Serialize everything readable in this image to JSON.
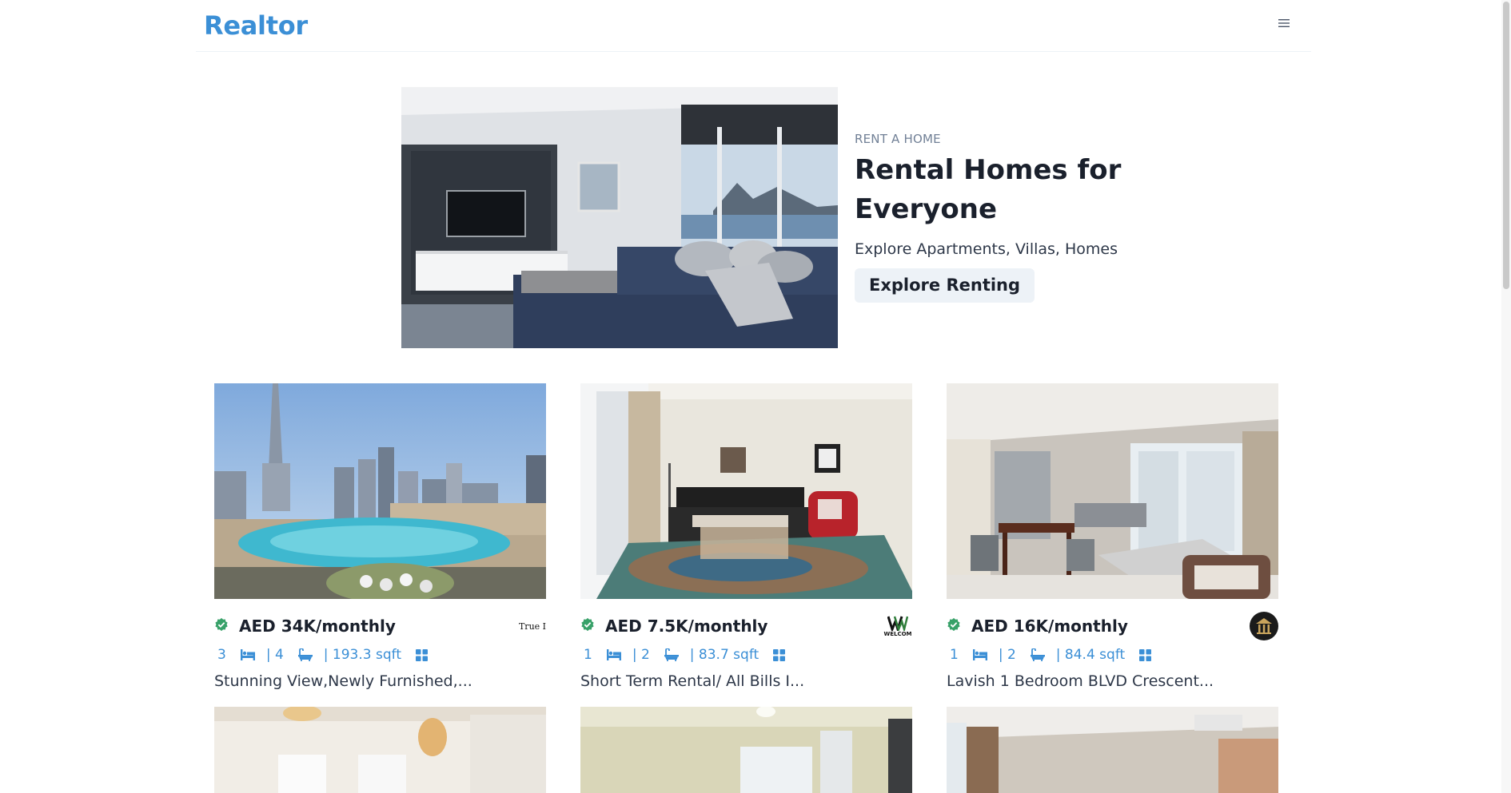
{
  "navbar": {
    "brand": "Realtor",
    "menu_icon": "hamburger-menu-icon"
  },
  "hero": {
    "eyebrow": "RENT A HOME",
    "title_line1": "Rental Homes for",
    "title_line2": "Everyone",
    "subtitle": "Explore Apartments, Villas, Homes",
    "button_label": "Explore Renting"
  },
  "listings": [
    {
      "price": "AED 34K/monthly",
      "rooms": "3",
      "baths": "| 4",
      "area": "| 193.3 sqft",
      "title": "Stunning View,Newly Furnished,...",
      "agency_text": "True I",
      "verified": true
    },
    {
      "price": "AED 7.5K/monthly",
      "rooms": "1",
      "baths": "| 2",
      "area": "| 83.7 sqft",
      "title": "Short Term Rental/ All Bills I...",
      "agency_text": "WELCOM",
      "verified": true
    },
    {
      "price": "AED 16K/monthly",
      "rooms": "1",
      "baths": "| 2",
      "area": "| 84.4 sqft",
      "title": "Lavish 1 Bedroom BLVD Crescent...",
      "agency_text": "",
      "verified": true
    }
  ],
  "colors": {
    "brand": "#3b8fd6",
    "verified": "#38a169",
    "button_bg": "#edf2f7"
  }
}
